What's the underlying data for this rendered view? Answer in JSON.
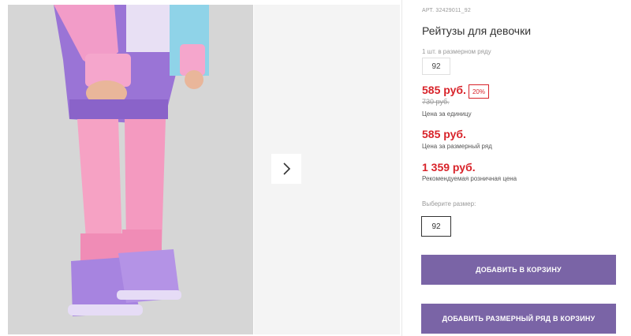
{
  "product": {
    "sku": "АРТ. 32429011_92",
    "title": "Рейтузы для девочки",
    "pack_label": "1 шт. в размерном ряду",
    "pack_size": "92"
  },
  "prices": {
    "unit_price": "585 руб.",
    "discount": "20%",
    "old_price": "730 руб.",
    "unit_caption": "Цена за единицу",
    "pack_price": "585 руб.",
    "pack_caption": "Цена за размерный ряд",
    "retail_price": "1 359 руб.",
    "retail_caption": "Рекомендуемая розничная цена"
  },
  "size": {
    "label": "Выберите размер:",
    "selected": "92"
  },
  "actions": {
    "add_to_cart": "Добавить в корзину",
    "add_pack_to_cart": "Добавить размерный ряд в корзину"
  },
  "colors": {
    "accent": "#7a64a6",
    "price_red": "#d8232a"
  },
  "icons": {
    "next": "chevron-right-icon"
  }
}
